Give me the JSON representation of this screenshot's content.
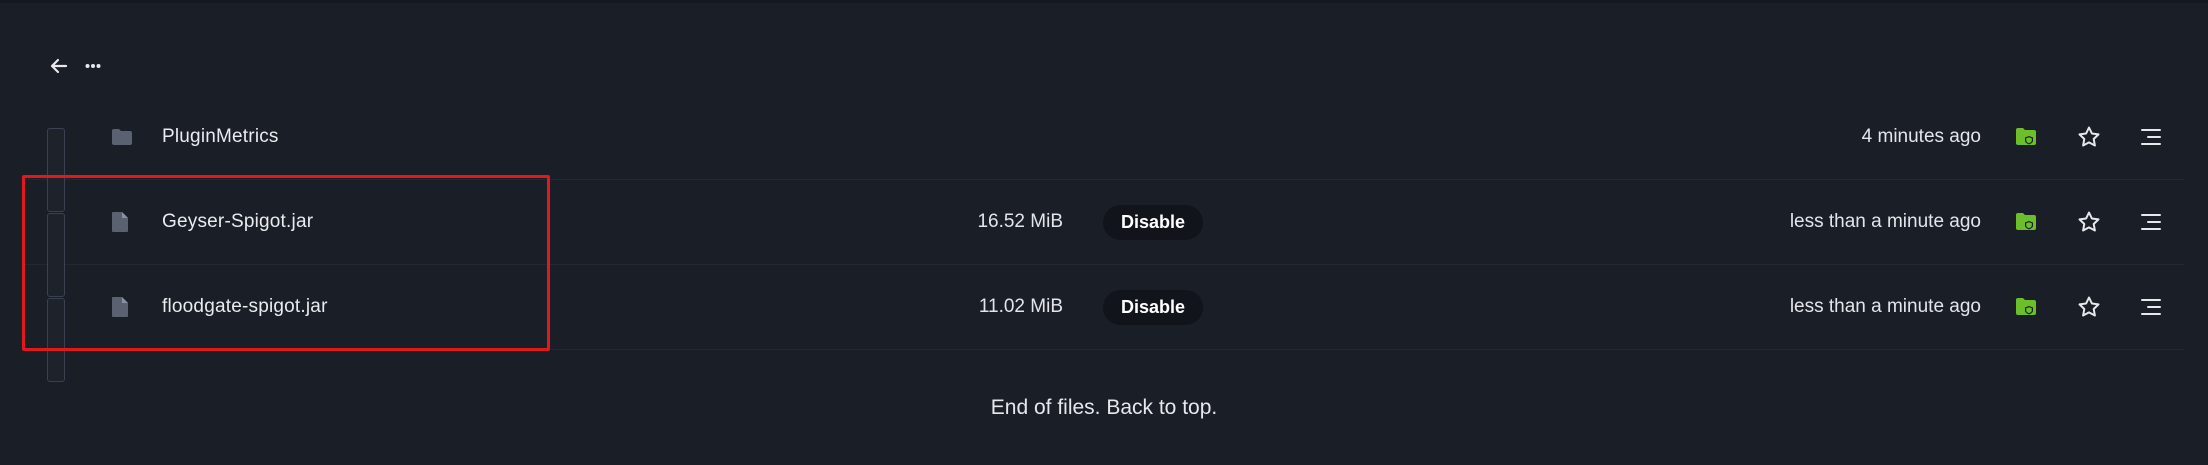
{
  "toolbar": {
    "back_icon": "arrow-left-icon",
    "more_icon": "more-horizontal-icon"
  },
  "files": [
    {
      "name": "PluginMetrics",
      "type_icon": "folder-icon",
      "action_label": "",
      "size": "",
      "modified": "4 minutes ago"
    },
    {
      "name": "Geyser-Spigot.jar",
      "type_icon": "file-icon",
      "action_label": "Disable",
      "size": "16.52 MiB",
      "modified": "less than a minute ago"
    },
    {
      "name": "floodgate-spigot.jar",
      "type_icon": "file-icon",
      "action_label": "Disable",
      "size": "11.02 MiB",
      "modified": "less than a minute ago"
    }
  ],
  "row_icons": {
    "pin": "folder-shield-icon",
    "star": "star-icon",
    "menu": "menu-icon"
  },
  "footer": {
    "text": "End of files. Back to top."
  },
  "colors": {
    "background": "#1a1e26",
    "accent_green": "#6cbe2a",
    "highlight_red": "#e0191c",
    "icon_grey": "#5a6272"
  }
}
